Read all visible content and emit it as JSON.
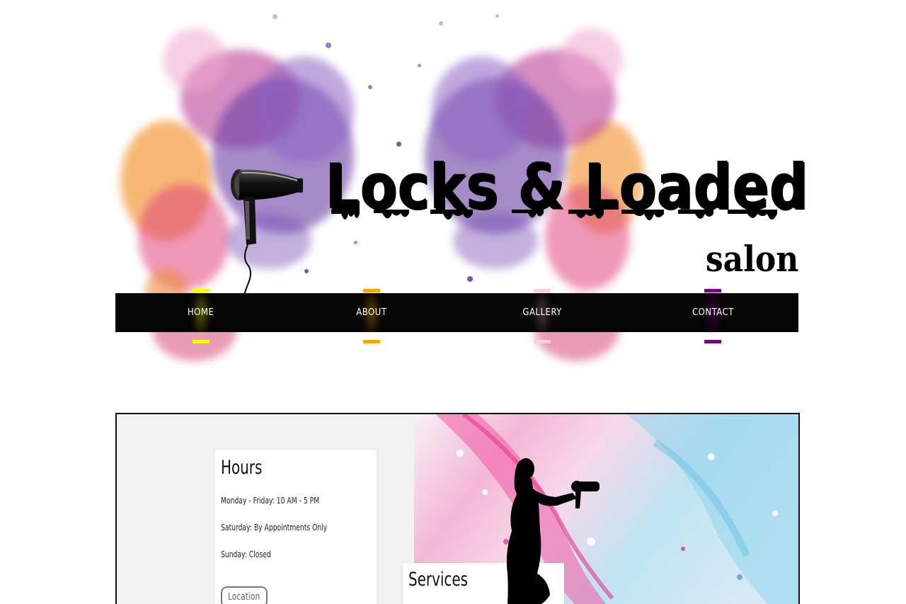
{
  "brand": {
    "title": "Locks & Loaded",
    "subtitle": "salon"
  },
  "nav": {
    "items": [
      {
        "label": "HOME",
        "glow": "#f7ff00"
      },
      {
        "label": "ABOUT",
        "glow": "#ffa500"
      },
      {
        "label": "GALLERY",
        "glow": "#ffc0cb"
      },
      {
        "label": "CONTACT",
        "glow": "#800080"
      }
    ]
  },
  "hours": {
    "title": "Hours",
    "lines": [
      "Monday - Friday: 10 AM - 5 PM",
      "Saturday: By Appointments Only",
      "Sunday: Closed"
    ],
    "location_label": "Location"
  },
  "services": {
    "title": "Services"
  },
  "icons": {
    "brand": "hair-dryer-icon",
    "silhouette": "stylist-silhouette"
  }
}
